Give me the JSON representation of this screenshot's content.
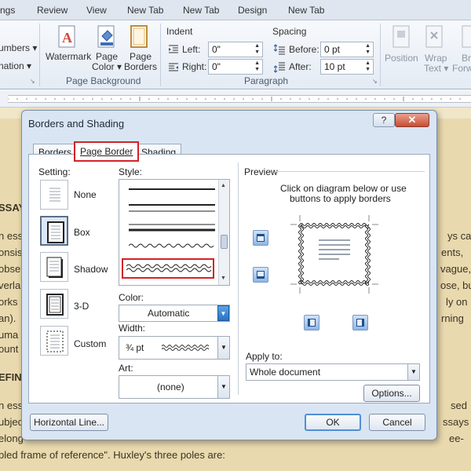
{
  "ribbon": {
    "tabs": [
      "ngs",
      "Review",
      "View",
      "New Tab",
      "New Tab",
      "Design",
      "New Tab"
    ],
    "left_items": [
      "umbers ▾",
      "nation ▾"
    ],
    "page_background": {
      "group_label": "Page Background",
      "watermark": "Watermark",
      "page_color_line1": "Page",
      "page_color_line2": "Color ▾",
      "page_borders_line1": "Page",
      "page_borders_line2": "Borders"
    },
    "paragraph": {
      "group_label": "Paragraph",
      "indent_title": "Indent",
      "left_label": "Left:",
      "left_value": "0\"",
      "right_label": "Right:",
      "right_value": "0\"",
      "spacing_title": "Spacing",
      "before_label": "Before:",
      "before_value": "0 pt",
      "after_label": "After:",
      "after_value": "10 pt"
    },
    "arrange": {
      "position_label": "Position",
      "wrap_line1": "Wrap",
      "wrap_line2": "Text ▾",
      "bring_line1": "Br",
      "bring_line2": "Forw"
    }
  },
  "document": {
    "lines": [
      {
        "text": "SSAY",
        "bold": true
      },
      {
        "text": "n ess",
        "right": "ys can"
      },
      {
        "text": "onsist",
        "right": "ents,"
      },
      {
        "text": "observ",
        "right": "vague,"
      },
      {
        "text": "verla",
        "right": "ose, but"
      },
      {
        "text": "orks",
        "right": "ly on"
      },
      {
        "text": "an).",
        "right": "rning"
      },
      {
        "text": "uma",
        "right": ""
      },
      {
        "text": "ount",
        "right": ""
      },
      {
        "text": "EFINI",
        "bold": true
      },
      {
        "text": "n ess",
        "right": "sed"
      },
      {
        "text": "ubjec",
        "right": "ssays"
      },
      {
        "text": "elong",
        "right": "ee-"
      },
      {
        "text": "bled frame of reference\". Huxley's three poles are:",
        "right": ""
      }
    ]
  },
  "dialog": {
    "title": "Borders and Shading",
    "help": "?",
    "close": "✕",
    "tabs": {
      "borders": "Borders",
      "page_border": "Page Border",
      "shading": "Shading"
    },
    "setting": {
      "label": "Setting:",
      "options": [
        "None",
        "Box",
        "Shadow",
        "3-D",
        "Custom"
      ]
    },
    "style_label": "Style:",
    "color_label": "Color:",
    "color_value": "Automatic",
    "width_label": "Width:",
    "width_value": "¾ pt",
    "art_label": "Art:",
    "art_value": "(none)",
    "preview": {
      "label": "Preview",
      "instructions_line1": "Click on diagram below or use",
      "instructions_line2": "buttons to apply borders"
    },
    "apply_to_label": "Apply to:",
    "apply_to_value": "Whole document",
    "options_button": "Options...",
    "horizontal_line_button": "Horizontal Line...",
    "ok_button": "OK",
    "cancel_button": "Cancel"
  }
}
